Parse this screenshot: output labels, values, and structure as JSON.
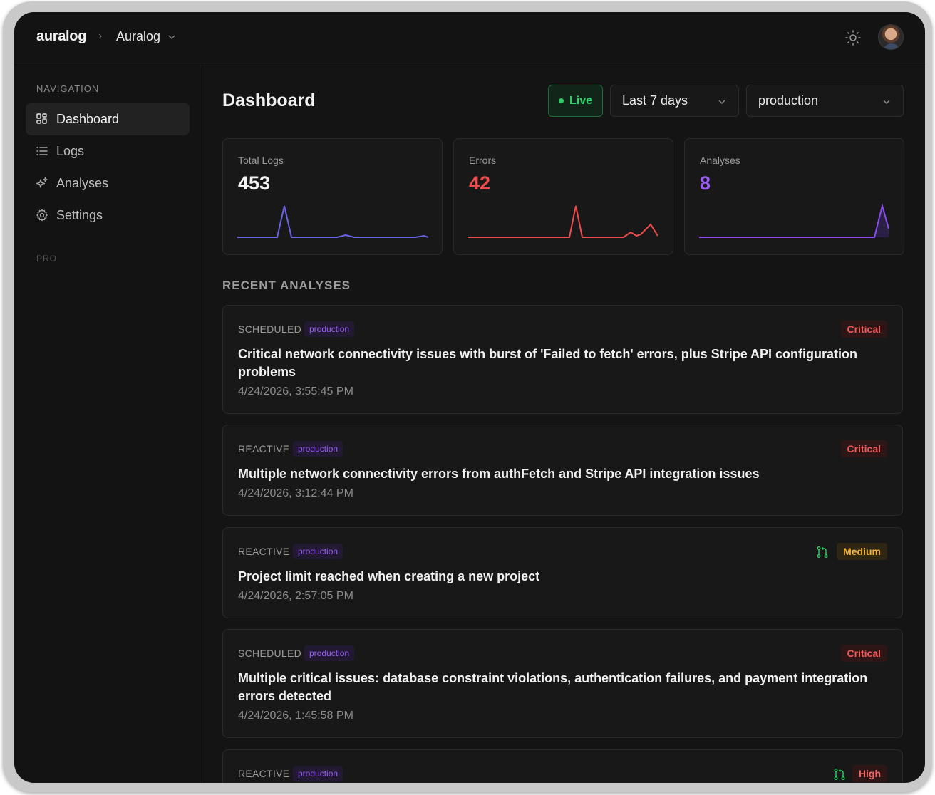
{
  "header": {
    "logo": "auralog",
    "breadcrumb_sep": "›",
    "project": "Auralog",
    "theme_icon": "sun-icon"
  },
  "sidebar": {
    "nav_heading": "NAVIGATION",
    "items": [
      {
        "label": "Dashboard",
        "icon": "grid-icon",
        "active": true
      },
      {
        "label": "Logs",
        "icon": "list-icon",
        "active": false
      },
      {
        "label": "Analyses",
        "icon": "sparkles-icon",
        "active": false
      },
      {
        "label": "Settings",
        "icon": "gear-icon",
        "active": false
      }
    ],
    "pro_heading": "PRO"
  },
  "main": {
    "title": "Dashboard",
    "live_label": "Live",
    "range": "Last 7 days",
    "environment": "production",
    "stats": [
      {
        "label": "Total Logs",
        "value": "453",
        "color": "#f3f3f3",
        "spark_color": "#6b63e6"
      },
      {
        "label": "Errors",
        "value": "42",
        "color": "#ef4b4b",
        "spark_color": "#ef4b4b"
      },
      {
        "label": "Analyses",
        "value": "8",
        "color": "#9b5cf6",
        "spark_color": "#8a4ef0"
      }
    ],
    "section_title": "RECENT ANALYSES",
    "analyses": [
      {
        "type": "SCHEDULED",
        "env": "production",
        "severity": "Critical",
        "has_pr": false,
        "title": "Critical network connectivity issues with burst of 'Failed to fetch' errors, plus Stripe API configuration problems",
        "date": "4/24/2026, 3:55:45 PM"
      },
      {
        "type": "REACTIVE",
        "env": "production",
        "severity": "Critical",
        "has_pr": false,
        "title": "Multiple network connectivity errors from authFetch and Stripe API integration issues",
        "date": "4/24/2026, 3:12:44 PM"
      },
      {
        "type": "REACTIVE",
        "env": "production",
        "severity": "Medium",
        "has_pr": true,
        "title": "Project limit reached when creating a new project",
        "date": "4/24/2026, 2:57:05 PM"
      },
      {
        "type": "SCHEDULED",
        "env": "production",
        "severity": "Critical",
        "has_pr": false,
        "title": "Multiple critical issues: database constraint violations, authentication failures, and payment integration errors detected",
        "date": "4/24/2026, 1:45:58 PM"
      },
      {
        "type": "REACTIVE",
        "env": "production",
        "severity": "High",
        "has_pr": true,
        "title": "",
        "date": ""
      }
    ]
  }
}
